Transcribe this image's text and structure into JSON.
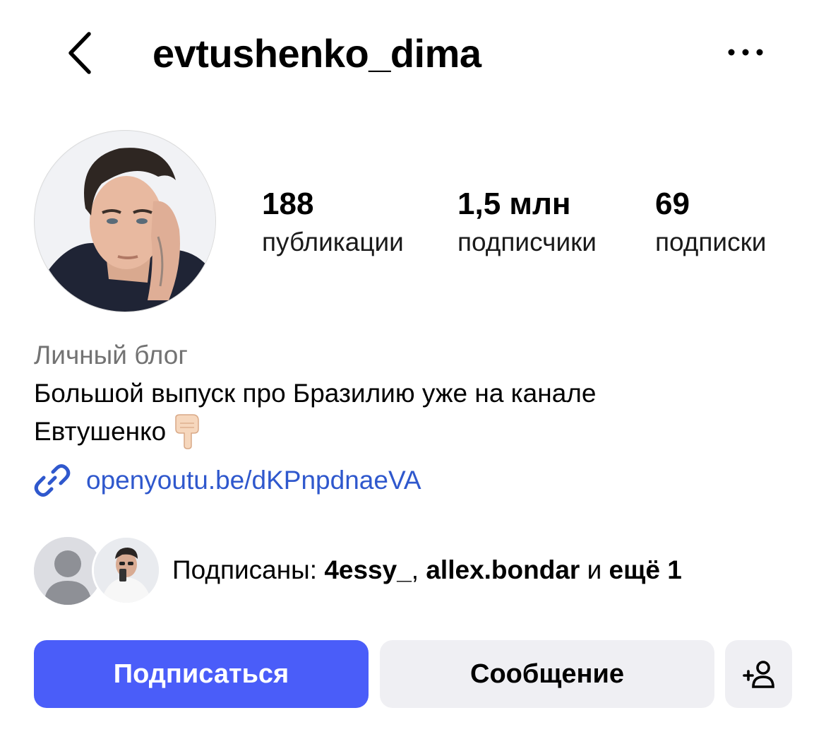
{
  "header": {
    "username": "evtushenko_dima",
    "back_icon": "chevron-left-icon",
    "more_icon": "more-horizontal-icon"
  },
  "profile": {
    "avatar_icon": "profile-photo",
    "stats": [
      {
        "value": "188",
        "label": "публикации"
      },
      {
        "value": "1,5 млн",
        "label": "подписчики"
      },
      {
        "value": "69",
        "label": "подписки"
      }
    ],
    "category": "Личный блог",
    "bio_line1": "Большой выпуск про Бразилию уже на канале",
    "bio_line2": "Евтушенко",
    "bio_emoji": "pointing-down-hand-icon",
    "link_icon": "link-icon",
    "link": "openyoutu.be/dKPnpdnaeVA"
  },
  "followed_by": {
    "prefix": "Подписаны: ",
    "user1": "4essy_",
    "separator": ", ",
    "user2": "allex.bondar",
    "conjunction": " и ",
    "more": "ещё 1"
  },
  "actions": {
    "follow": "Подписаться",
    "message": "Сообщение",
    "add_user_icon": "add-user-icon"
  },
  "colors": {
    "follow_button": "#4a5df9",
    "secondary_button": "#efeff3",
    "link": "#2f58cd",
    "category_text": "#737373"
  }
}
